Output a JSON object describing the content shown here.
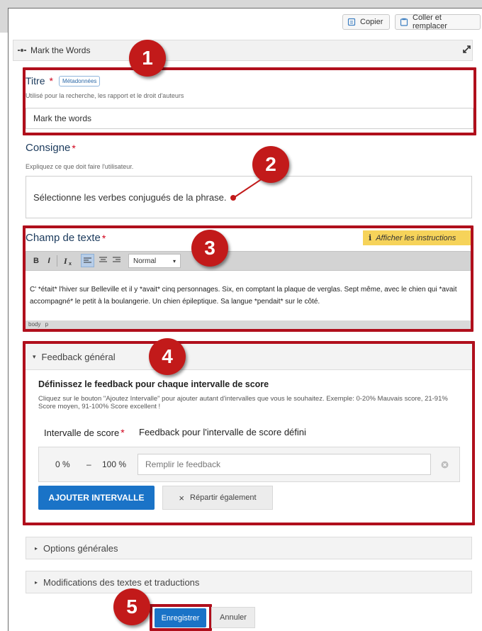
{
  "toolbar": {
    "copy_label": "Copier",
    "paste_replace_label": "Coller et remplacer"
  },
  "header": {
    "title": "Mark the Words"
  },
  "title_field": {
    "label": "Titre",
    "required_mark": "*",
    "metadata_tag": "Métadonnées",
    "description": "Utilisé pour la recherche, les rapport et le droit d'auteurs",
    "value": "Mark the words"
  },
  "instruction_field": {
    "label": "Consigne",
    "required_mark": "*",
    "description": "Expliquez ce que doit faire l'utilisateur.",
    "value": "Sélectionne les verbes conjugués de la phrase."
  },
  "text_field": {
    "label": "Champ de texte",
    "required_mark": "*",
    "show_instructions": "Afficher les instructions",
    "format_bold": "B",
    "format_italic": "I",
    "format_clear": "Ix",
    "format_select": "Normal",
    "content": "C' *était* l'hiver sur Belleville et il y *avait* cinq personnages. Six, en comptant la plaque de verglas. Sept même, avec le chien qui *avait accompagné* le petit à la boulangerie. Un chien épileptique. Sa langue *pendait* sur le côté.",
    "path_body": "body",
    "path_p": "p"
  },
  "feedback": {
    "section_title": "Feedback général",
    "heading": "Définissez le feedback pour chaque intervalle de score",
    "help_text": "Cliquez sur le bouton \"Ajoutez Intervalle\" pour ajouter autant d'intervalles que vous le souhaitez. Exemple: 0-20% Mauvais score, 21-91% Score moyen, 91-100% Score excellent !",
    "col_interval": "Intervalle de score",
    "required_mark": "*",
    "col_feedback": "Feedback pour l'intervalle de score défini",
    "range_from": "0 %",
    "range_sep": "–",
    "range_to": "100 %",
    "feedback_placeholder": "Remplir le feedback",
    "add_interval_label": "AJOUTER INTERVALLE",
    "distribute_label": "Répartir également"
  },
  "sections": {
    "general_options": "Options générales",
    "texts_translations": "Modifications des textes et traductions"
  },
  "actions": {
    "save_label": "Enregistrer",
    "cancel_label": "Annuler"
  },
  "annotations": {
    "n1": "1",
    "n2": "2",
    "n3": "3",
    "n4": "4",
    "n5": "5"
  },
  "colors": {
    "annotation_red": "#b00f1c",
    "primary_blue": "#1a73c7",
    "label_blue": "#1b3a5c",
    "instructions_yellow": "#f6d35a"
  }
}
